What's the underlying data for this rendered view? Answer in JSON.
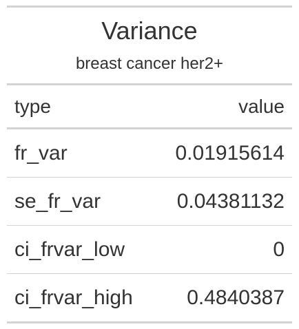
{
  "table": {
    "title": "Variance",
    "subtitle": "breast cancer her2+",
    "columns": [
      "type",
      "value"
    ],
    "rows": [
      {
        "type": "fr_var",
        "value": "0.01915614"
      },
      {
        "type": "se_fr_var",
        "value": "0.04381132"
      },
      {
        "type": "ci_frvar_low",
        "value": "0"
      },
      {
        "type": "ci_frvar_high",
        "value": "0.4840387"
      }
    ]
  }
}
